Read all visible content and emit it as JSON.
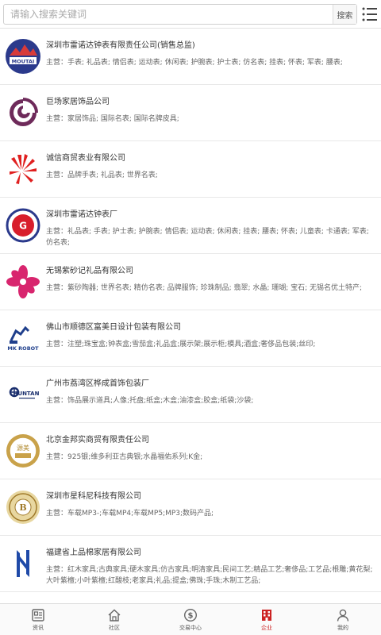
{
  "search": {
    "placeholder": "请输入搜索关键词",
    "button_label": "搜索"
  },
  "companies": [
    {
      "name": "深圳市雷诺达钟表有限责任公司(销售总监)",
      "main": "主营：手表; 礼品表; 情侣表; 运动表; 休闲表; 护腕表; 护士表; 仿名表; 挂表; 怀表; 军表; 腰表;",
      "logo_icon": "moutai-logo-icon",
      "logo_text": "MOUTAI"
    },
    {
      "name": "巨场家居饰品公司",
      "main": "主营：家居饰品; 国际名表; 国际名牌皮具;",
      "logo_icon": "spiral-logo-icon"
    },
    {
      "name": "诚信商贸表业有限公司",
      "main": "主营：品牌手表; 礼品表; 世界名表;",
      "logo_icon": "red-fan-logo-icon"
    },
    {
      "name": "深圳市雷诺达钟表厂",
      "main": "主营：礼品表; 手表; 护士表; 护腕表; 情侣表; 运动表; 休闲表; 挂表; 腰表; 怀表; 儿童表; 卡通表; 军表; 仿名表;",
      "logo_icon": "g-circle-logo-icon",
      "logo_text": "G"
    },
    {
      "name": "无锡紫砂记礼品有限公司",
      "main": "主营：紫砂陶器; 世界名表; 精仿名表; 品牌服饰; 珍珠制品; 翡翠; 水晶; 珊瑚; 宝石; 无锡名优土特产;",
      "logo_icon": "pink-flower-logo-icon"
    },
    {
      "name": "佛山市顺德区富美日设计包装有限公司",
      "main": "主营：注塑;珠宝盒;钟表盒;雪茄盒;礼品盒;展示架;展示柜;模具;酒盒;奢侈品包装;丝印;",
      "logo_icon": "robot-logo-icon",
      "logo_text": "MK ROBOT"
    },
    {
      "name": "广州市荔湾区桦成首饰包装厂",
      "main": "主营：饰品展示道具;人像;托盘;纸盒;木盒;油漆盒;胶盒;纸袋;沙袋;",
      "logo_icon": "huntan-logo-icon",
      "logo_text": "HUNTAN"
    },
    {
      "name": "北京金邦实商贸有限责任公司",
      "main": "主营：925银;维多利亚古典银;水晶福佑系列;K金;",
      "logo_icon": "gold-badge-logo-icon",
      "logo_text": "源美"
    },
    {
      "name": "深圳市星科尼科技有限公司",
      "main": "主营：车载MP3-;车载MP4;车载MP5;MP3;数码产品;",
      "logo_icon": "gold-seal-logo-icon",
      "logo_text": "B"
    },
    {
      "name": "福建省上品棉家居有限公司",
      "main": "主营：红木家具;古典家具;硬木家具;仿古家具;明清家具;民间工艺;精品工艺;奢侈品;工艺品;根雕;黄花梨;大叶紫檀;小叶紫檀;红酸枝;老家具;礼品;提盒;佛珠;手珠;木制工艺品;",
      "logo_icon": "blue-pillar-logo-icon"
    },
    {
      "name": "",
      "main": "",
      "logo_icon": ""
    }
  ],
  "tabbar": [
    {
      "label": "资讯",
      "icon": "news-icon"
    },
    {
      "label": "社区",
      "icon": "home-icon"
    },
    {
      "label": "交易中心",
      "icon": "dollar-icon"
    },
    {
      "label": "企业",
      "icon": "building-icon",
      "active": true
    },
    {
      "label": "我的",
      "icon": "user-icon"
    }
  ],
  "colors": {
    "accent": "#cc2222",
    "border": "#e8e8e8",
    "text_secondary": "#666666"
  }
}
